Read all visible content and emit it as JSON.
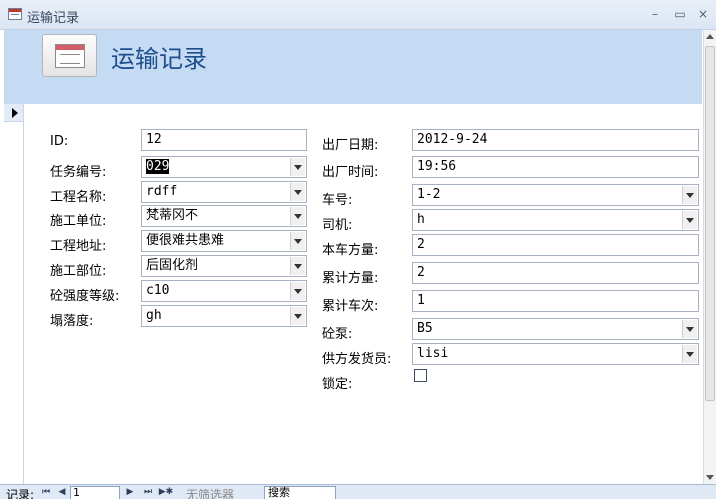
{
  "window": {
    "title": "运输记录",
    "minimize": "–",
    "restore": "▭",
    "close": "×"
  },
  "header": {
    "title": "运输记录"
  },
  "left_fields": [
    {
      "label": "ID:",
      "value": "12",
      "type": "text"
    },
    {
      "label": "任务编号:",
      "value": "029",
      "type": "combo",
      "selected": true
    },
    {
      "label": "工程名称:",
      "value": "rdff",
      "type": "combo"
    },
    {
      "label": "施工单位:",
      "value": "梵蒂冈不",
      "type": "combo"
    },
    {
      "label": "工程地址:",
      "value": "便很难共患难",
      "type": "combo"
    },
    {
      "label": "施工部位:",
      "value": "后固化剂",
      "type": "combo"
    },
    {
      "label": "砼强度等级:",
      "value": "c10",
      "type": "combo"
    },
    {
      "label": "塌落度:",
      "value": "gh",
      "type": "combo"
    }
  ],
  "right_fields": [
    {
      "label": "出厂日期:",
      "value": "2012-9-24",
      "type": "text"
    },
    {
      "label": "出厂时间:",
      "value": "19:56",
      "type": "text"
    },
    {
      "label": "车号:",
      "value": "1-2",
      "type": "combo"
    },
    {
      "label": "司机:",
      "value": "h",
      "type": "combo"
    },
    {
      "label": "本车方量:",
      "value": "2",
      "type": "text"
    },
    {
      "label": "累计方量:",
      "value": "2",
      "type": "text"
    },
    {
      "label": "累计车次:",
      "value": "1",
      "type": "text"
    },
    {
      "label": "砼泵:",
      "value": "B5",
      "type": "combo"
    },
    {
      "label": "供方发货员:",
      "value": "lisi",
      "type": "combo"
    },
    {
      "label": "锁定:",
      "value": "",
      "type": "checkbox",
      "checked": false
    }
  ],
  "navigation": {
    "record_label": "记录:",
    "first": "⏮",
    "prev": "◀",
    "current": "1",
    "next": "▶",
    "last": "⏭",
    "new": "▶✱",
    "filter_label": "无筛选器",
    "search_label": "搜索"
  }
}
